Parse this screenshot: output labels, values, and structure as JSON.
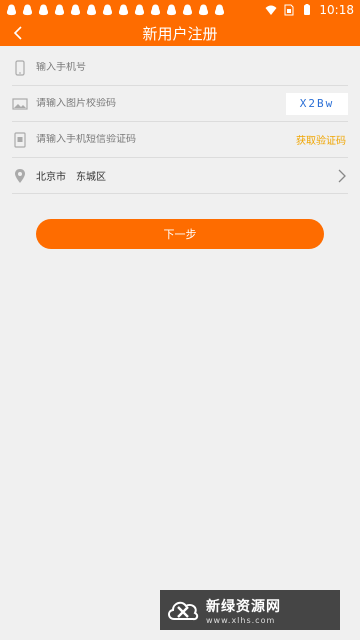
{
  "status_bar": {
    "time": "10:18",
    "notification_icons": [
      "qq-icon",
      "qq-icon",
      "qq-icon",
      "qq-icon",
      "qq-icon",
      "qq-icon",
      "qq-icon",
      "qq-icon",
      "qq-icon",
      "qq-icon",
      "qq-icon",
      "qq-icon",
      "qq-icon",
      "qq-icon"
    ]
  },
  "nav": {
    "title": "新用户注册"
  },
  "form": {
    "phone": {
      "placeholder": "输入手机号"
    },
    "image_captcha": {
      "placeholder": "请输入图片校验码",
      "captcha_text": "X2Bw"
    },
    "sms_code": {
      "placeholder": "请输入手机短信验证码",
      "link": "获取验证码"
    },
    "region": {
      "city": "北京市",
      "district": "东城区"
    }
  },
  "next_button": "下一步",
  "watermark": {
    "title": "新绿资源网",
    "url": "www.xlhs.com"
  },
  "colors": {
    "accent": "#fe6c00",
    "link": "#f0a500",
    "background": "#f0f0f0"
  }
}
